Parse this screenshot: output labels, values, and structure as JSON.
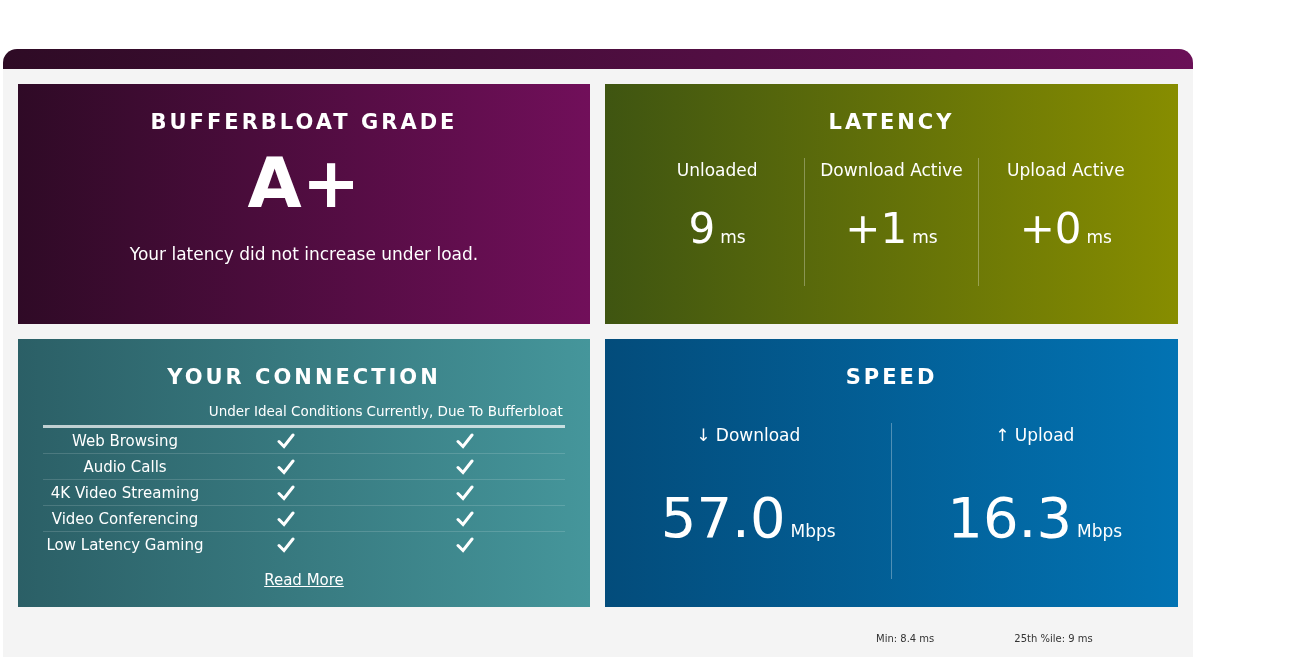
{
  "grade": {
    "title": "BUFFERBLOAT GRADE",
    "grade": "A+",
    "message": "Your latency did not increase under load."
  },
  "latency": {
    "title": "LATENCY",
    "items": [
      {
        "label": "Unloaded",
        "value": "9",
        "unit": "ms"
      },
      {
        "label": "Download Active",
        "value": "+1",
        "unit": "ms"
      },
      {
        "label": "Upload Active",
        "value": "+0",
        "unit": "ms"
      }
    ]
  },
  "connection": {
    "title": "YOUR CONNECTION",
    "columns": [
      "Under Ideal Conditions",
      "Currently, Due To Bufferbloat"
    ],
    "rows": [
      {
        "label": "Web Browsing",
        "ideal": true,
        "current": true
      },
      {
        "label": "Audio Calls",
        "ideal": true,
        "current": true
      },
      {
        "label": "4K Video Streaming",
        "ideal": true,
        "current": true
      },
      {
        "label": "Video Conferencing",
        "ideal": true,
        "current": true
      },
      {
        "label": "Low Latency Gaming",
        "ideal": true,
        "current": true
      }
    ],
    "link": "Read More"
  },
  "speed": {
    "title": "SPEED",
    "items": [
      {
        "arrow": "↓",
        "label": "Download",
        "value": "57.0",
        "unit": "Mbps"
      },
      {
        "arrow": "↑",
        "label": "Upload",
        "value": "16.3",
        "unit": "Mbps"
      }
    ]
  },
  "stats": [
    "Min: 8.4 ms",
    "25th %ile: 9 ms"
  ]
}
